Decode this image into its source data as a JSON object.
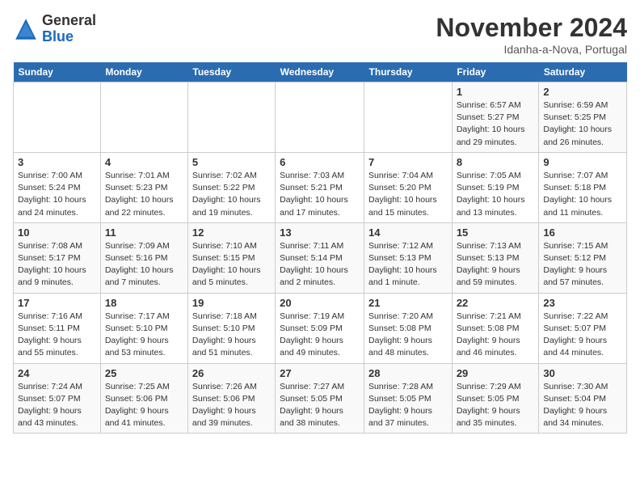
{
  "header": {
    "logo_line1": "General",
    "logo_line2": "Blue",
    "month": "November 2024",
    "location": "Idanha-a-Nova, Portugal"
  },
  "days_of_week": [
    "Sunday",
    "Monday",
    "Tuesday",
    "Wednesday",
    "Thursday",
    "Friday",
    "Saturday"
  ],
  "weeks": [
    [
      {
        "day": "",
        "info": ""
      },
      {
        "day": "",
        "info": ""
      },
      {
        "day": "",
        "info": ""
      },
      {
        "day": "",
        "info": ""
      },
      {
        "day": "",
        "info": ""
      },
      {
        "day": "1",
        "info": "Sunrise: 6:57 AM\nSunset: 5:27 PM\nDaylight: 10 hours and 29 minutes."
      },
      {
        "day": "2",
        "info": "Sunrise: 6:59 AM\nSunset: 5:25 PM\nDaylight: 10 hours and 26 minutes."
      }
    ],
    [
      {
        "day": "3",
        "info": "Sunrise: 7:00 AM\nSunset: 5:24 PM\nDaylight: 10 hours and 24 minutes."
      },
      {
        "day": "4",
        "info": "Sunrise: 7:01 AM\nSunset: 5:23 PM\nDaylight: 10 hours and 22 minutes."
      },
      {
        "day": "5",
        "info": "Sunrise: 7:02 AM\nSunset: 5:22 PM\nDaylight: 10 hours and 19 minutes."
      },
      {
        "day": "6",
        "info": "Sunrise: 7:03 AM\nSunset: 5:21 PM\nDaylight: 10 hours and 17 minutes."
      },
      {
        "day": "7",
        "info": "Sunrise: 7:04 AM\nSunset: 5:20 PM\nDaylight: 10 hours and 15 minutes."
      },
      {
        "day": "8",
        "info": "Sunrise: 7:05 AM\nSunset: 5:19 PM\nDaylight: 10 hours and 13 minutes."
      },
      {
        "day": "9",
        "info": "Sunrise: 7:07 AM\nSunset: 5:18 PM\nDaylight: 10 hours and 11 minutes."
      }
    ],
    [
      {
        "day": "10",
        "info": "Sunrise: 7:08 AM\nSunset: 5:17 PM\nDaylight: 10 hours and 9 minutes."
      },
      {
        "day": "11",
        "info": "Sunrise: 7:09 AM\nSunset: 5:16 PM\nDaylight: 10 hours and 7 minutes."
      },
      {
        "day": "12",
        "info": "Sunrise: 7:10 AM\nSunset: 5:15 PM\nDaylight: 10 hours and 5 minutes."
      },
      {
        "day": "13",
        "info": "Sunrise: 7:11 AM\nSunset: 5:14 PM\nDaylight: 10 hours and 2 minutes."
      },
      {
        "day": "14",
        "info": "Sunrise: 7:12 AM\nSunset: 5:13 PM\nDaylight: 10 hours and 1 minute."
      },
      {
        "day": "15",
        "info": "Sunrise: 7:13 AM\nSunset: 5:13 PM\nDaylight: 9 hours and 59 minutes."
      },
      {
        "day": "16",
        "info": "Sunrise: 7:15 AM\nSunset: 5:12 PM\nDaylight: 9 hours and 57 minutes."
      }
    ],
    [
      {
        "day": "17",
        "info": "Sunrise: 7:16 AM\nSunset: 5:11 PM\nDaylight: 9 hours and 55 minutes."
      },
      {
        "day": "18",
        "info": "Sunrise: 7:17 AM\nSunset: 5:10 PM\nDaylight: 9 hours and 53 minutes."
      },
      {
        "day": "19",
        "info": "Sunrise: 7:18 AM\nSunset: 5:10 PM\nDaylight: 9 hours and 51 minutes."
      },
      {
        "day": "20",
        "info": "Sunrise: 7:19 AM\nSunset: 5:09 PM\nDaylight: 9 hours and 49 minutes."
      },
      {
        "day": "21",
        "info": "Sunrise: 7:20 AM\nSunset: 5:08 PM\nDaylight: 9 hours and 48 minutes."
      },
      {
        "day": "22",
        "info": "Sunrise: 7:21 AM\nSunset: 5:08 PM\nDaylight: 9 hours and 46 minutes."
      },
      {
        "day": "23",
        "info": "Sunrise: 7:22 AM\nSunset: 5:07 PM\nDaylight: 9 hours and 44 minutes."
      }
    ],
    [
      {
        "day": "24",
        "info": "Sunrise: 7:24 AM\nSunset: 5:07 PM\nDaylight: 9 hours and 43 minutes."
      },
      {
        "day": "25",
        "info": "Sunrise: 7:25 AM\nSunset: 5:06 PM\nDaylight: 9 hours and 41 minutes."
      },
      {
        "day": "26",
        "info": "Sunrise: 7:26 AM\nSunset: 5:06 PM\nDaylight: 9 hours and 39 minutes."
      },
      {
        "day": "27",
        "info": "Sunrise: 7:27 AM\nSunset: 5:05 PM\nDaylight: 9 hours and 38 minutes."
      },
      {
        "day": "28",
        "info": "Sunrise: 7:28 AM\nSunset: 5:05 PM\nDaylight: 9 hours and 37 minutes."
      },
      {
        "day": "29",
        "info": "Sunrise: 7:29 AM\nSunset: 5:05 PM\nDaylight: 9 hours and 35 minutes."
      },
      {
        "day": "30",
        "info": "Sunrise: 7:30 AM\nSunset: 5:04 PM\nDaylight: 9 hours and 34 minutes."
      }
    ]
  ]
}
